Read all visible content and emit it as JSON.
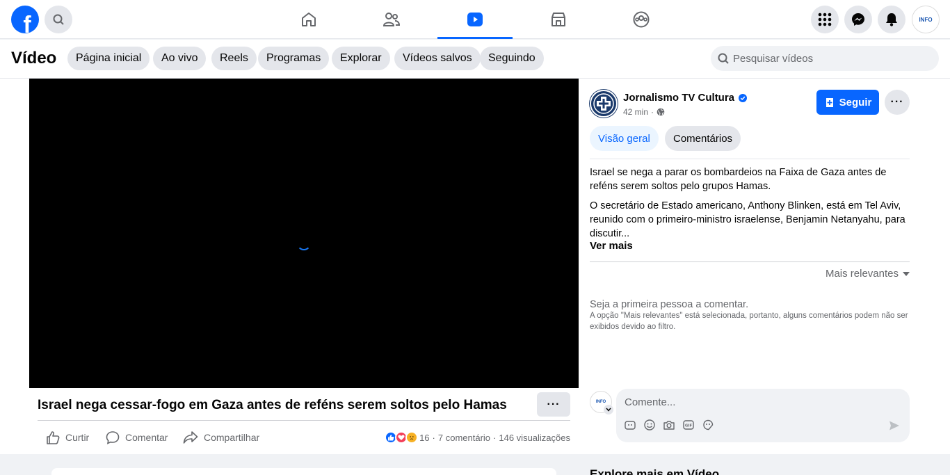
{
  "topnav": {
    "logo": "f",
    "icons": [
      "search-icon",
      "home-icon",
      "friends-icon",
      "video-icon",
      "marketplace-icon",
      "groups-icon",
      "menu-grid-icon",
      "messenger-icon",
      "bell-icon"
    ],
    "active_tab": "video",
    "accent": "#0866ff",
    "profile_label": "INFO"
  },
  "subheader": {
    "title": "Vídeo",
    "chips": [
      "Página inicial",
      "Ao vivo",
      "Reels",
      "Programas",
      "Explorar",
      "Vídeos salvos",
      "Seguindo"
    ],
    "search_placeholder": "Pesquisar vídeos"
  },
  "video": {
    "title": "Israel nega cessar-fogo em Gaza antes de reféns serem soltos pelo Hamas",
    "actions": {
      "like": "Curtir",
      "comment": "Comentar",
      "share": "Compartilhar"
    },
    "stats": {
      "reactions": "16",
      "comments": "7 comentário",
      "views": "146 visualizações",
      "separator": "·"
    }
  },
  "post": {
    "page_name": "Jornalismo TV Cultura",
    "time": "42 min",
    "time_separator": "·",
    "follow_label": "Seguir",
    "tabs": {
      "overview": "Visão geral",
      "comments": "Comentários"
    },
    "paragraph_1": "Israel se nega a parar os bombardeios na Faixa de Gaza antes de reféns serem soltos pelo grupos Hamas.",
    "paragraph_2": "O secretário de Estado americano, Anthony Blinken, está em Tel Aviv, reunido com o primeiro-ministro israelense, Benjamin Netanyahu, para discutir...",
    "see_more": "Ver mais",
    "sort_label": "Mais relevantes",
    "empty_title": "Seja a primeira pessoa a comentar.",
    "empty_note": "A opção \"Mais relevantes\" está selecionada, portanto, alguns comentários podem não ser exibidos devido ao filtro.",
    "comment_placeholder": "Comente...",
    "commenter_label": "INFO"
  },
  "explore": {
    "title": "Explore mais em Vídeo"
  }
}
